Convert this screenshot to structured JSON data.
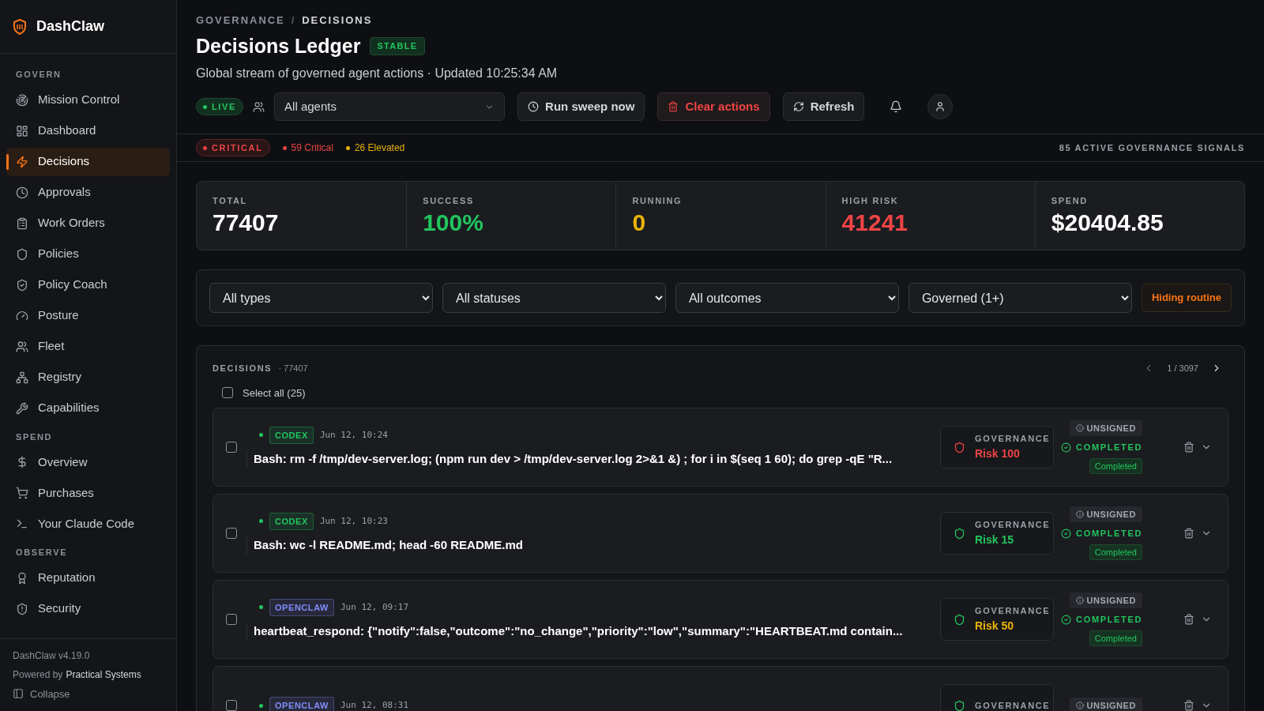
{
  "sidebar": {
    "brand": "DashClaw",
    "sections": [
      {
        "title": "GOVERN",
        "items": [
          {
            "label": "Mission Control",
            "selected": false
          },
          {
            "label": "Dashboard",
            "selected": false
          },
          {
            "label": "Decisions",
            "selected": true
          },
          {
            "label": "Approvals",
            "selected": false
          },
          {
            "label": "Work Orders",
            "selected": false
          },
          {
            "label": "Policies",
            "selected": false
          },
          {
            "label": "Policy Coach",
            "selected": false
          },
          {
            "label": "Posture",
            "selected": false
          },
          {
            "label": "Fleet",
            "selected": false
          },
          {
            "label": "Registry",
            "selected": false
          },
          {
            "label": "Capabilities",
            "selected": false
          }
        ]
      },
      {
        "title": "SPEND",
        "items": [
          {
            "label": "Overview",
            "selected": false
          },
          {
            "label": "Purchases",
            "selected": false
          },
          {
            "label": "Your Claude Code",
            "selected": false
          }
        ]
      },
      {
        "title": "OBSERVE",
        "items": [
          {
            "label": "Reputation",
            "selected": false
          },
          {
            "label": "Security",
            "selected": false
          }
        ]
      }
    ],
    "version": "DashClaw v4.19.0",
    "powered_by": "Powered by",
    "company": "Practical Systems",
    "collapse": "Collapse"
  },
  "header": {
    "breadcrumb": [
      "GOVERNANCE",
      "DECISIONS"
    ],
    "separator": "/",
    "title": "Decisions Ledger",
    "badge": "STABLE",
    "subtitle": "Global stream of governed agent actions · Updated 10:25:34 AM"
  },
  "toolbar": {
    "live": "LIVE",
    "agent_filter": "All agents",
    "buttons": [
      {
        "label": "Run sweep now",
        "kind": "sweep"
      },
      {
        "label": "Clear actions",
        "kind": "danger"
      },
      {
        "label": "Refresh",
        "kind": "refresh"
      }
    ]
  },
  "alert_strip": {
    "level": "CRITICAL",
    "counts": [
      {
        "label": "59 Critical",
        "color": "#ef4444"
      },
      {
        "label": "26 Elevated",
        "color": "#eab308"
      }
    ],
    "signals": "85 ACTIVE GOVERNANCE SIGNALS"
  },
  "stats": [
    {
      "label": "TOTAL",
      "value": "77407",
      "color": "#ffffff"
    },
    {
      "label": "SUCCESS",
      "value": "100%",
      "color": "#22c55e"
    },
    {
      "label": "RUNNING",
      "value": "0",
      "color": "#eab308"
    },
    {
      "label": "HIGH RISK",
      "value": "41241",
      "color": "#ef4444"
    },
    {
      "label": "SPEND",
      "value": "$20404.85",
      "color": "#ffffff"
    }
  ],
  "filters": {
    "selects": [
      "All types",
      "All statuses",
      "All outcomes",
      "Governed (1+)"
    ],
    "toggle": "Hiding routine"
  },
  "decisions": {
    "title": "DECISIONS",
    "count": "· 77407",
    "page": "1 / 3097",
    "select_all": "Select all (25)",
    "select_all_checked": false,
    "rows": [
      {
        "checked": false,
        "agent": {
          "label": "CODEX",
          "color": "#22c55e"
        },
        "time": "Jun 12, 10:24",
        "command": "Bash: rm -f /tmp/dev-server.log; (npm run dev > /tmp/dev-server.log 2>&1 &) ; for i in $(seq 1 60); do grep -qE \"R...",
        "governance": "GOVERNANCE",
        "risk": {
          "label": "Risk 100",
          "color": "#ef4444"
        },
        "flagged": true,
        "signature": "UNSIGNED",
        "status": "COMPLETED",
        "outcome": "Completed"
      },
      {
        "checked": false,
        "agent": {
          "label": "CODEX",
          "color": "#22c55e"
        },
        "time": "Jun 12, 10:23",
        "command": "Bash: wc -l README.md; head -60 README.md",
        "governance": "GOVERNANCE",
        "risk": {
          "label": "Risk 15",
          "color": "#22c55e"
        },
        "flagged": false,
        "signature": "UNSIGNED",
        "status": "COMPLETED",
        "outcome": "Completed"
      },
      {
        "checked": false,
        "agent": {
          "label": "OPENCLAW",
          "color": "#818cf8"
        },
        "time": "Jun 12, 09:17",
        "command": "heartbeat_respond: {\"notify\":false,\"outcome\":\"no_change\",\"priority\":\"low\",\"summary\":\"HEARTBEAT.md contain...",
        "governance": "GOVERNANCE",
        "risk": {
          "label": "Risk 50",
          "color": "#eab308"
        },
        "flagged": false,
        "signature": "UNSIGNED",
        "status": "COMPLETED",
        "outcome": "Completed"
      },
      {
        "checked": false,
        "agent": {
          "label": "OPENCLAW",
          "color": "#818cf8"
        },
        "time": "Jun 12, 08:31",
        "governance": "GOVERNANCE",
        "flagged": false,
        "signature": "UNSIGNED"
      }
    ]
  }
}
